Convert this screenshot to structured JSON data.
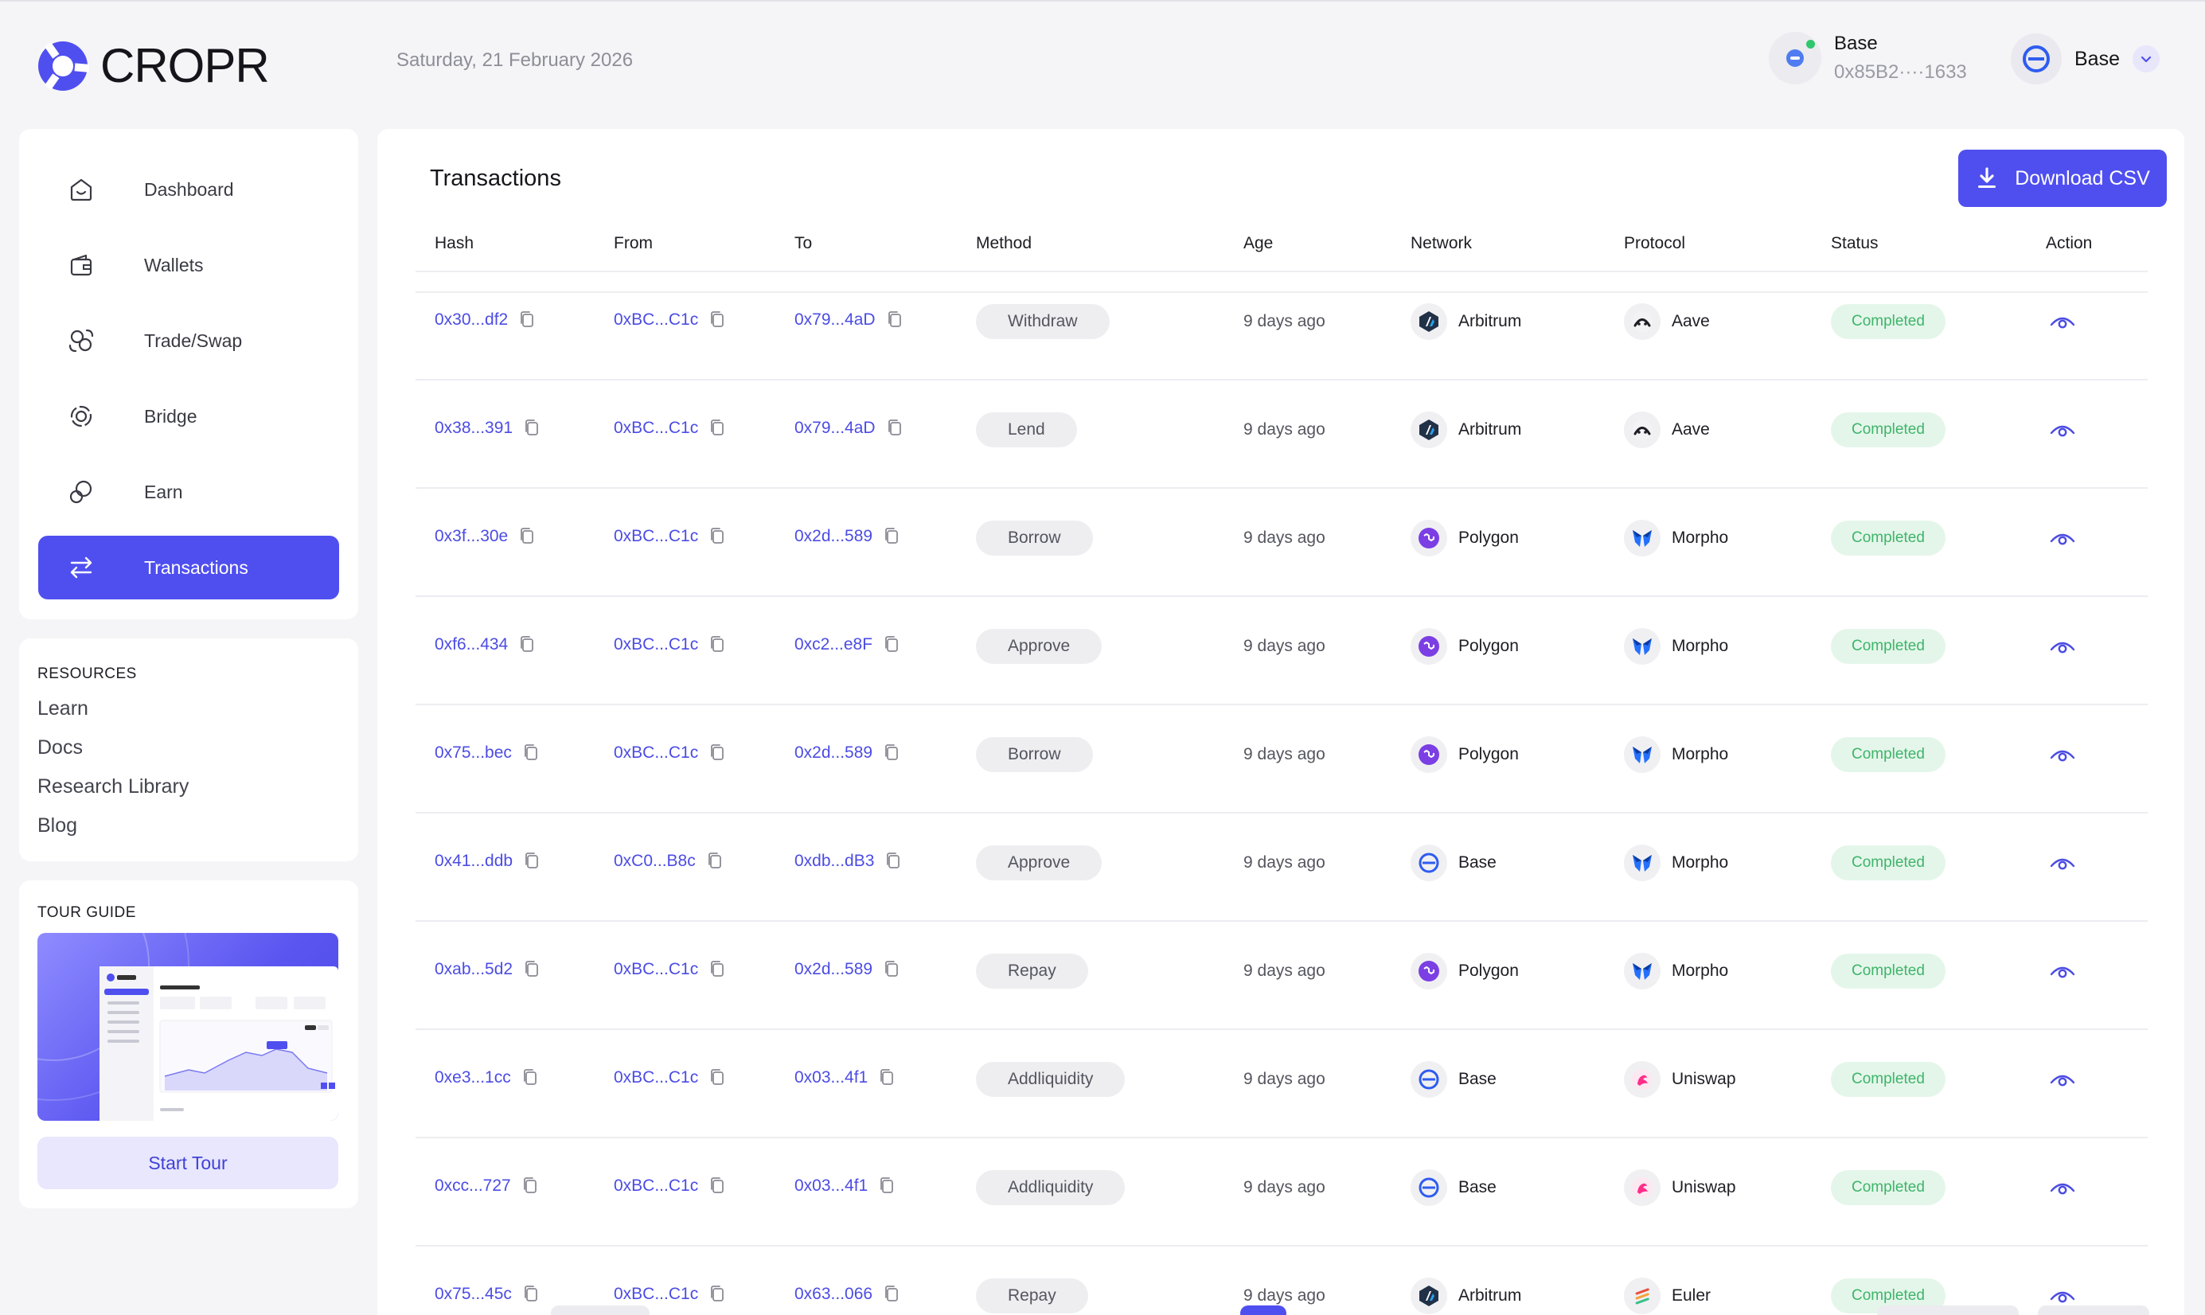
{
  "brand": {
    "name": "CROPR",
    "accent": "#4f4ff0"
  },
  "header": {
    "date": "Saturday, 21 February 2026",
    "wallet": {
      "network": "Base",
      "address": "0x85B2····1633"
    },
    "network_select": {
      "label": "Base"
    }
  },
  "sidebar": {
    "items": [
      {
        "label": "Dashboard",
        "icon": "home-icon",
        "active": false
      },
      {
        "label": "Wallets",
        "icon": "wallet-icon",
        "active": false
      },
      {
        "label": "Trade/Swap",
        "icon": "swap-icon",
        "active": false
      },
      {
        "label": "Bridge",
        "icon": "bridge-icon",
        "active": false
      },
      {
        "label": "Earn",
        "icon": "earn-icon",
        "active": false
      },
      {
        "label": "Transactions",
        "icon": "transfer-arrows-icon",
        "active": true
      }
    ],
    "resources": {
      "title": "RESOURCES",
      "links": [
        "Learn",
        "Docs",
        "Research Library",
        "Blog"
      ]
    },
    "tour": {
      "title": "TOUR GUIDE",
      "button": "Start Tour"
    }
  },
  "main": {
    "title": "Transactions",
    "download_button": "Download CSV",
    "columns": [
      "Hash",
      "From",
      "To",
      "Method",
      "Age",
      "Network",
      "Protocol",
      "Status",
      "Action"
    ],
    "rows": [
      {
        "hash": "0x30...df2",
        "from": "0xBC...C1c",
        "to": "0x79...4aD",
        "method": "Withdraw",
        "age": "9 days ago",
        "network": "Arbitrum",
        "protocol": "Aave",
        "status": "Completed"
      },
      {
        "hash": "0x38...391",
        "from": "0xBC...C1c",
        "to": "0x79...4aD",
        "method": "Lend",
        "age": "9 days ago",
        "network": "Arbitrum",
        "protocol": "Aave",
        "status": "Completed"
      },
      {
        "hash": "0x3f...30e",
        "from": "0xBC...C1c",
        "to": "0x2d...589",
        "method": "Borrow",
        "age": "9 days ago",
        "network": "Polygon",
        "protocol": "Morpho",
        "status": "Completed"
      },
      {
        "hash": "0xf6...434",
        "from": "0xBC...C1c",
        "to": "0xc2...e8F",
        "method": "Approve",
        "age": "9 days ago",
        "network": "Polygon",
        "protocol": "Morpho",
        "status": "Completed"
      },
      {
        "hash": "0x75...bec",
        "from": "0xBC...C1c",
        "to": "0x2d...589",
        "method": "Borrow",
        "age": "9 days ago",
        "network": "Polygon",
        "protocol": "Morpho",
        "status": "Completed"
      },
      {
        "hash": "0x41...ddb",
        "from": "0xC0...B8c",
        "to": "0xdb...dB3",
        "method": "Approve",
        "age": "9 days ago",
        "network": "Base",
        "protocol": "Morpho",
        "status": "Completed"
      },
      {
        "hash": "0xab...5d2",
        "from": "0xBC...C1c",
        "to": "0x2d...589",
        "method": "Repay",
        "age": "9 days ago",
        "network": "Polygon",
        "protocol": "Morpho",
        "status": "Completed"
      },
      {
        "hash": "0xe3...1cc",
        "from": "0xBC...C1c",
        "to": "0x03...4f1",
        "method": "Addliquidity",
        "age": "9 days ago",
        "network": "Base",
        "protocol": "Uniswap",
        "status": "Completed"
      },
      {
        "hash": "0xcc...727",
        "from": "0xBC...C1c",
        "to": "0x03...4f1",
        "method": "Addliquidity",
        "age": "9 days ago",
        "network": "Base",
        "protocol": "Uniswap",
        "status": "Completed"
      },
      {
        "hash": "0x75...45c",
        "from": "0xBC...C1c",
        "to": "0x63...066",
        "method": "Repay",
        "age": "9 days ago",
        "network": "Arbitrum",
        "protocol": "Euler",
        "status": "Completed"
      }
    ]
  }
}
